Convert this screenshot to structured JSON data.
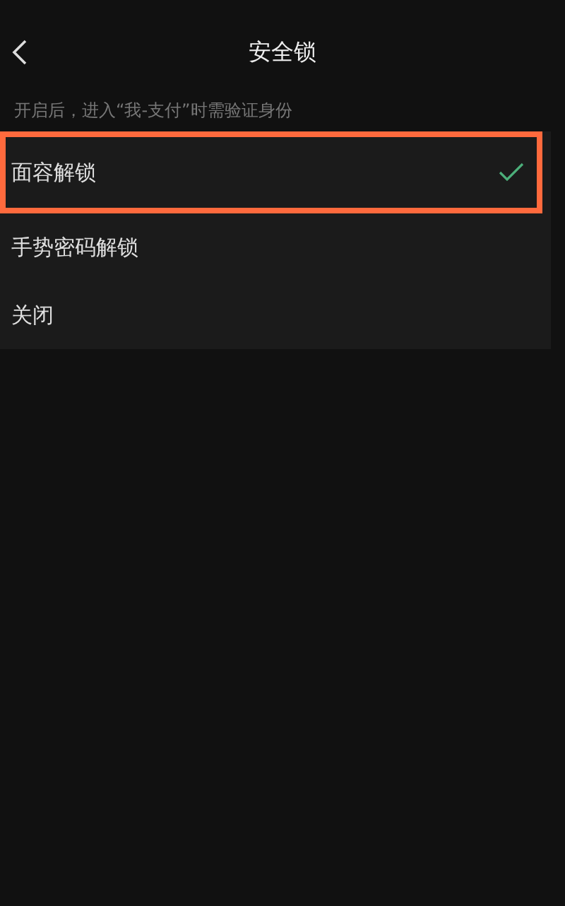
{
  "header": {
    "title": "安全锁"
  },
  "hint": "开启后，进入“我-支付”时需验证身份",
  "options": [
    {
      "label": "面容解锁",
      "selected": true,
      "highlighted": true
    },
    {
      "label": "手势密码解锁",
      "selected": false,
      "highlighted": false
    },
    {
      "label": "关闭",
      "selected": false,
      "highlighted": false
    }
  ]
}
